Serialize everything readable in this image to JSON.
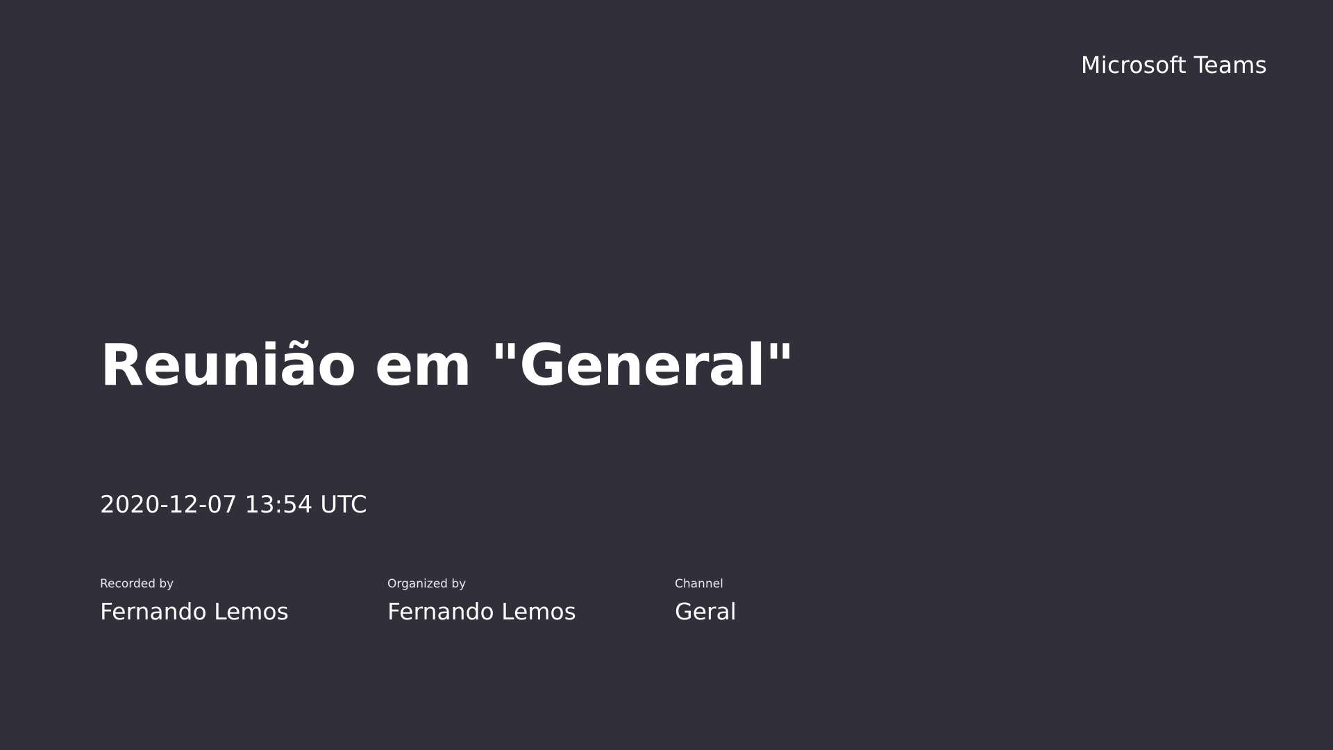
{
  "brand": {
    "name": "Microsoft Teams"
  },
  "meeting": {
    "title": "Reunião em \"General\"",
    "datetime": "2020-12-07 13:54 UTC"
  },
  "details": {
    "recorded_by": {
      "label": "Recorded by",
      "value": "Fernando Lemos"
    },
    "organized_by": {
      "label": "Organized by",
      "value": "Fernando Lemos"
    },
    "channel": {
      "label": "Channel",
      "value": "Geral"
    }
  },
  "colors": {
    "background": "#302f3a",
    "text": "#ffffff"
  }
}
